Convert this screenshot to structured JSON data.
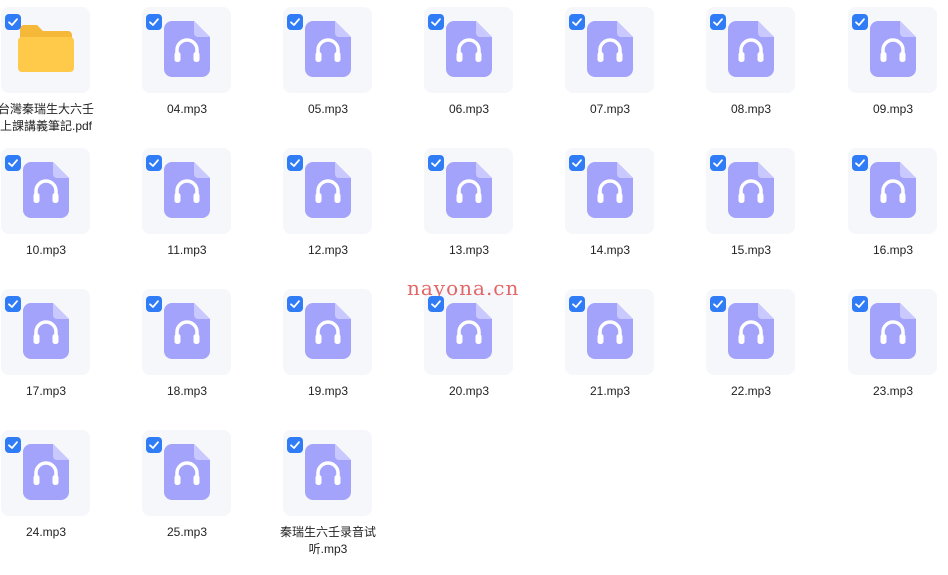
{
  "files": [
    {
      "name": "台灣秦瑞生大六壬上課講義筆記.pdf",
      "type": "folder",
      "selected": true
    },
    {
      "name": "04.mp3",
      "type": "audio",
      "selected": true
    },
    {
      "name": "05.mp3",
      "type": "audio",
      "selected": true
    },
    {
      "name": "06.mp3",
      "type": "audio",
      "selected": true
    },
    {
      "name": "07.mp3",
      "type": "audio",
      "selected": true
    },
    {
      "name": "08.mp3",
      "type": "audio",
      "selected": true
    },
    {
      "name": "09.mp3",
      "type": "audio",
      "selected": true
    },
    {
      "name": "10.mp3",
      "type": "audio",
      "selected": true
    },
    {
      "name": "11.mp3",
      "type": "audio",
      "selected": true
    },
    {
      "name": "12.mp3",
      "type": "audio",
      "selected": true
    },
    {
      "name": "13.mp3",
      "type": "audio",
      "selected": true
    },
    {
      "name": "14.mp3",
      "type": "audio",
      "selected": true
    },
    {
      "name": "15.mp3",
      "type": "audio",
      "selected": true
    },
    {
      "name": "16.mp3",
      "type": "audio",
      "selected": true
    },
    {
      "name": "17.mp3",
      "type": "audio",
      "selected": true
    },
    {
      "name": "18.mp3",
      "type": "audio",
      "selected": true
    },
    {
      "name": "19.mp3",
      "type": "audio",
      "selected": true
    },
    {
      "name": "20.mp3",
      "type": "audio",
      "selected": true
    },
    {
      "name": "21.mp3",
      "type": "audio",
      "selected": true
    },
    {
      "name": "22.mp3",
      "type": "audio",
      "selected": true
    },
    {
      "name": "23.mp3",
      "type": "audio",
      "selected": true
    },
    {
      "name": "24.mp3",
      "type": "audio",
      "selected": true
    },
    {
      "name": "25.mp3",
      "type": "audio",
      "selected": true
    },
    {
      "name": "秦瑞生六壬录音试听.mp3",
      "type": "audio",
      "selected": true
    }
  ],
  "watermark": "nayona.cn",
  "colors": {
    "audio_icon": "#a4a3fb",
    "folder_icon": "#ffc94a",
    "checkbox": "#2f7cf6",
    "thumb_bg": "#f6f7fb"
  }
}
